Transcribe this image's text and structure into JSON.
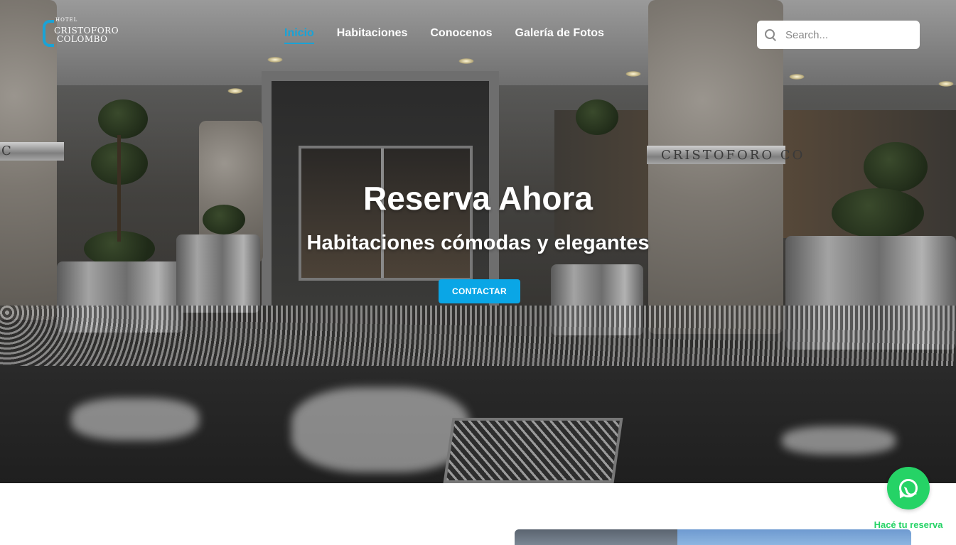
{
  "logo": {
    "small": "HOTEL",
    "line1": "CRISTOFORO",
    "line2": "COLOMBO"
  },
  "nav": {
    "items": [
      {
        "label": "Inicio",
        "active": true
      },
      {
        "label": "Habitaciones",
        "active": false
      },
      {
        "label": "Conocenos",
        "active": false
      },
      {
        "label": "Galería de Fotos",
        "active": false
      }
    ]
  },
  "search": {
    "placeholder": "Search...",
    "value": ""
  },
  "hero": {
    "title": "Reserva Ahora",
    "subtitle": "Habitaciones cómodas y elegantes",
    "cta_label": "CONTACTAR",
    "sign_left": "C",
    "sign_right": "CRISTOFORO CO"
  },
  "whatsapp": {
    "label": "Hacé tu reserva",
    "icon": "whatsapp-icon"
  },
  "colors": {
    "accent": "#1aa3d6",
    "cta": "#0aa6e6",
    "whatsapp": "#25d366"
  }
}
